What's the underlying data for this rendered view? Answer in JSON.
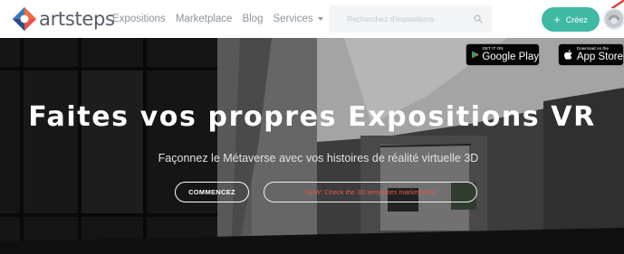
{
  "brand": {
    "name": "artsteps"
  },
  "nav": {
    "items": [
      {
        "label": "Expositions"
      },
      {
        "label": "Marketplace"
      },
      {
        "label": "Blog"
      },
      {
        "label": "Services"
      }
    ]
  },
  "search": {
    "placeholder": "Recherchez d'expositions",
    "icon": "search-icon"
  },
  "create_button": {
    "label": "Créez",
    "icon": "plus-icon"
  },
  "stores": {
    "google_play": {
      "small": "GET IT ON",
      "big": "Google Play"
    },
    "app_store": {
      "small": "Download on the",
      "big": "App Store"
    }
  },
  "hero": {
    "title": "Faites vos propres Expositions VR",
    "subtitle": "Façonnez le Métaverse avec vos histoires de réalité virtuelle 3D",
    "primary_cta": "COMMENCEZ",
    "secondary_cta": "NEW: Check the 3D templates marketplace"
  },
  "colors": {
    "accent": "#3fb8a4",
    "link_red": "#e2574c",
    "logo_orange": "#f26a3d",
    "logo_blue": "#2f5d9a"
  }
}
